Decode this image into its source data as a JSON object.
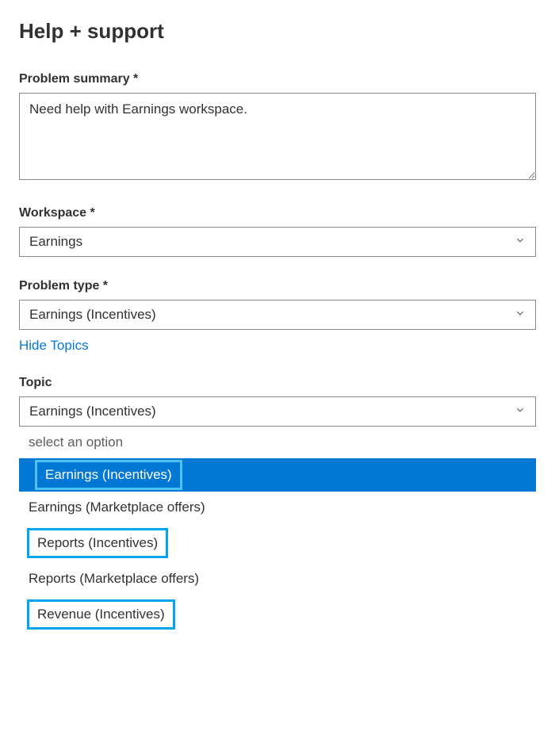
{
  "page_title": "Help + support",
  "fields": {
    "problem_summary": {
      "label": "Problem summary *",
      "value": "Need help with Earnings workspace."
    },
    "workspace": {
      "label": "Workspace *",
      "selected": "Earnings"
    },
    "problem_type": {
      "label": "Problem type *",
      "selected": "Earnings (Incentives)",
      "toggle_link": "Hide Topics"
    },
    "topic": {
      "label": "Topic",
      "selected": "Earnings (Incentives)",
      "options": {
        "placeholder": "select an option",
        "opt1": "Earnings (Incentives)",
        "opt2": "Earnings (Marketplace offers)",
        "opt3": "Reports (Incentives)",
        "opt4": "Reports (Marketplace offers)",
        "opt5": "Revenue (Incentives)"
      }
    }
  }
}
